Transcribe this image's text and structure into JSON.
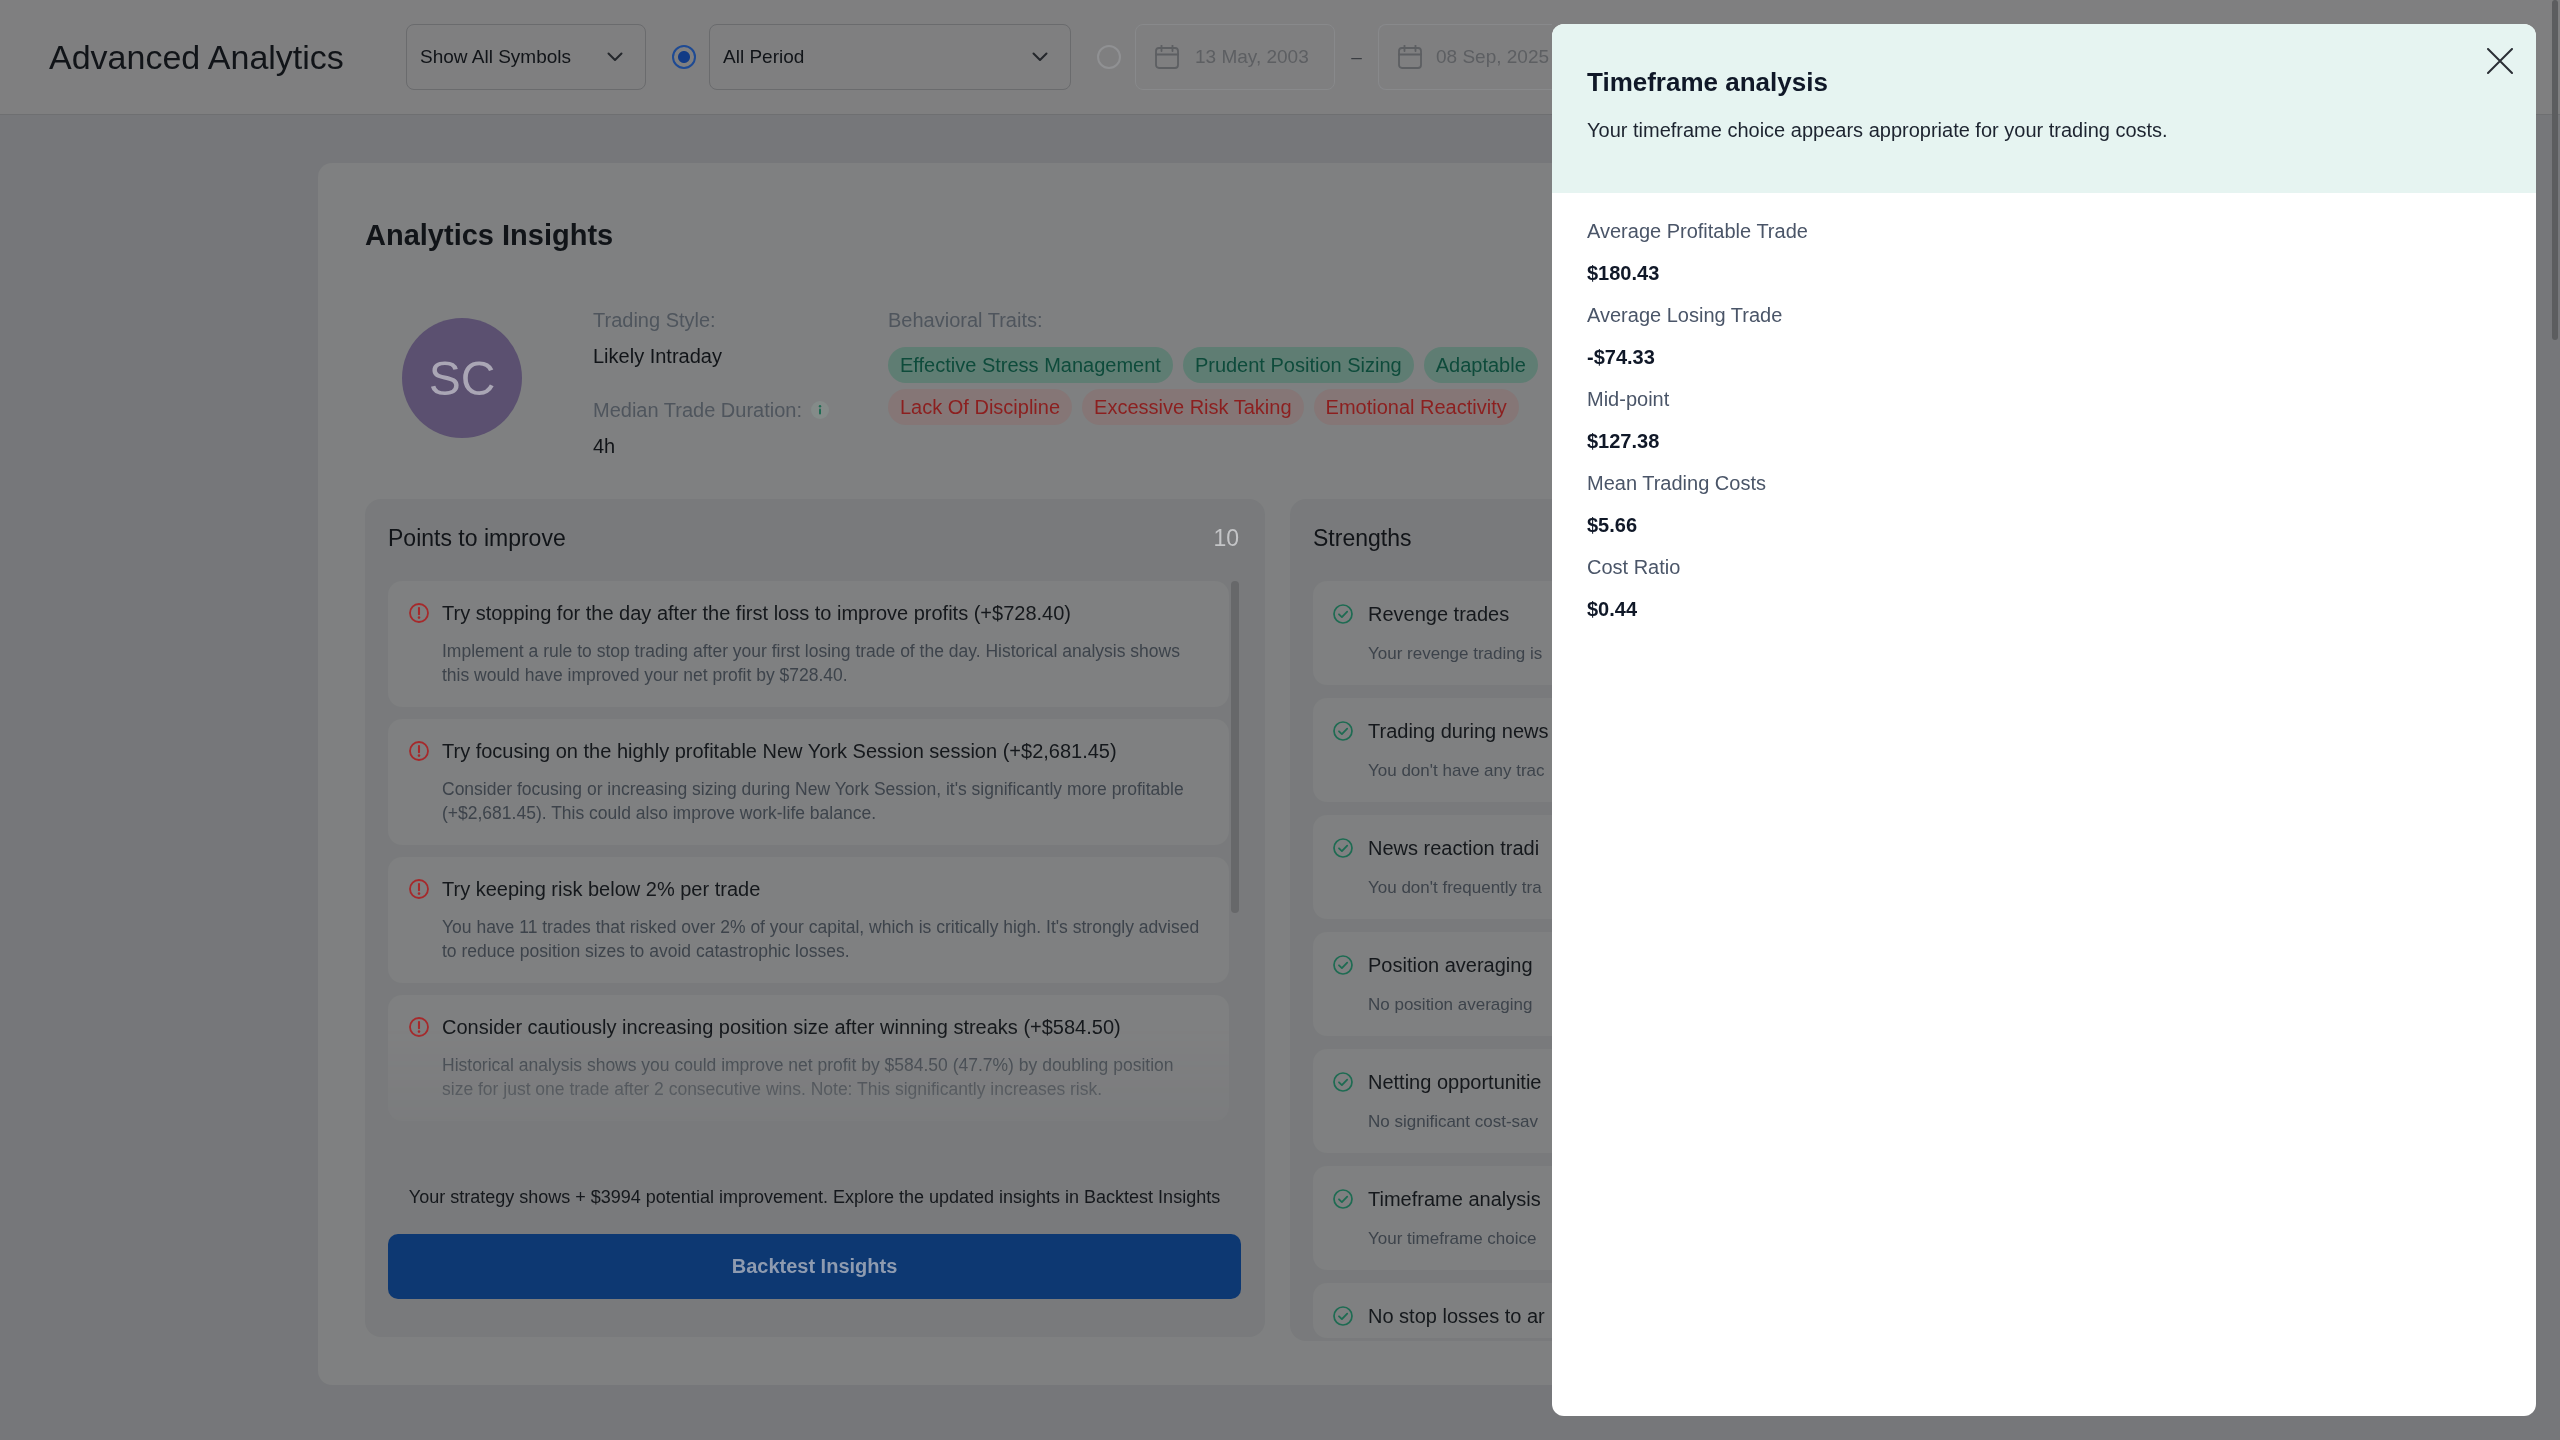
{
  "header": {
    "title": "Advanced Analytics",
    "symbol_filter": {
      "value": "Show All Symbols"
    },
    "period_options": [
      {
        "kind": "preset",
        "selected": true,
        "value": "All Period"
      },
      {
        "kind": "range",
        "selected": false,
        "start": "13 May, 2003",
        "separator": "–",
        "end": "08 Sep, 2025"
      }
    ]
  },
  "insights": {
    "title": "Analytics Insights",
    "profile": {
      "initials": "SC",
      "style_label": "Trading Style:",
      "style": "Likely Intraday",
      "duration_label": "Median Trade Duration:",
      "duration": "4h",
      "traits_label": "Behavioral Traits:",
      "traits": [
        {
          "label": "Effective Stress Management",
          "kind": "positive"
        },
        {
          "label": "Prudent Position Sizing",
          "kind": "positive"
        },
        {
          "label": "Adaptable",
          "kind": "positive"
        },
        {
          "label": "Lack Of Discipline",
          "kind": "negative"
        },
        {
          "label": "Excessive Risk Taking",
          "kind": "negative"
        },
        {
          "label": "Emotional Reactivity",
          "kind": "negative"
        }
      ]
    },
    "improvements": {
      "title": "Points to improve",
      "count": "10",
      "items": [
        {
          "title": "Try stopping for the day after the first loss to improve profits (+$728.40)",
          "description": "Implement a rule to stop trading after your first losing trade of the day. Historical analysis shows this would have improved your net profit by $728.40."
        },
        {
          "title": "Try focusing on the highly profitable New York Session session (+$2,681.45)",
          "description": "Consider focusing or increasing sizing during New York Session, it's significantly more profitable (+$2,681.45). This could also improve work-life balance."
        },
        {
          "title": "Try keeping risk below 2% per trade",
          "description": "You have 11 trades that risked over 2% of your capital, which is critically high. It's strongly advised to reduce position sizes to avoid catastrophic losses."
        },
        {
          "title": "Consider cautiously increasing position size after winning streaks (+$584.50)",
          "description": "Historical analysis shows you could improve net profit by $584.50 (47.7%) by doubling position size for just one trade after 2 consecutive wins. Note: This significantly increases risk."
        }
      ],
      "summary": "Your strategy shows + $3994 potential improvement. Explore the updated insights in Backtest Insights",
      "button": "Backtest Insights"
    },
    "strengths": {
      "title": "Strengths",
      "items": [
        {
          "title": "Revenge trades",
          "description": "Your revenge trading is"
        },
        {
          "title": "Trading during news",
          "description": "You don't have any trac"
        },
        {
          "title": "News reaction tradi",
          "description": "You don't frequently tra"
        },
        {
          "title": "Position averaging",
          "description": "No position averaging"
        },
        {
          "title": "Netting opportunitie",
          "description": "No significant cost-sav"
        },
        {
          "title": "Timeframe analysis",
          "description": "Your timeframe choice"
        },
        {
          "title": "No stop losses to ar"
        }
      ]
    }
  },
  "drawer": {
    "title": "Timeframe analysis",
    "subtitle": "Your timeframe choice appears appropriate for your trading costs.",
    "metrics": [
      {
        "label": "Average Profitable Trade",
        "value": "$180.43"
      },
      {
        "label": "Average Losing Trade",
        "value": "-$74.33"
      },
      {
        "label": "Mid-point",
        "value": "$127.38"
      },
      {
        "label": "Mean Trading Costs",
        "value": "$5.66"
      },
      {
        "label": "Cost Ratio",
        "value": "$0.44"
      }
    ]
  }
}
